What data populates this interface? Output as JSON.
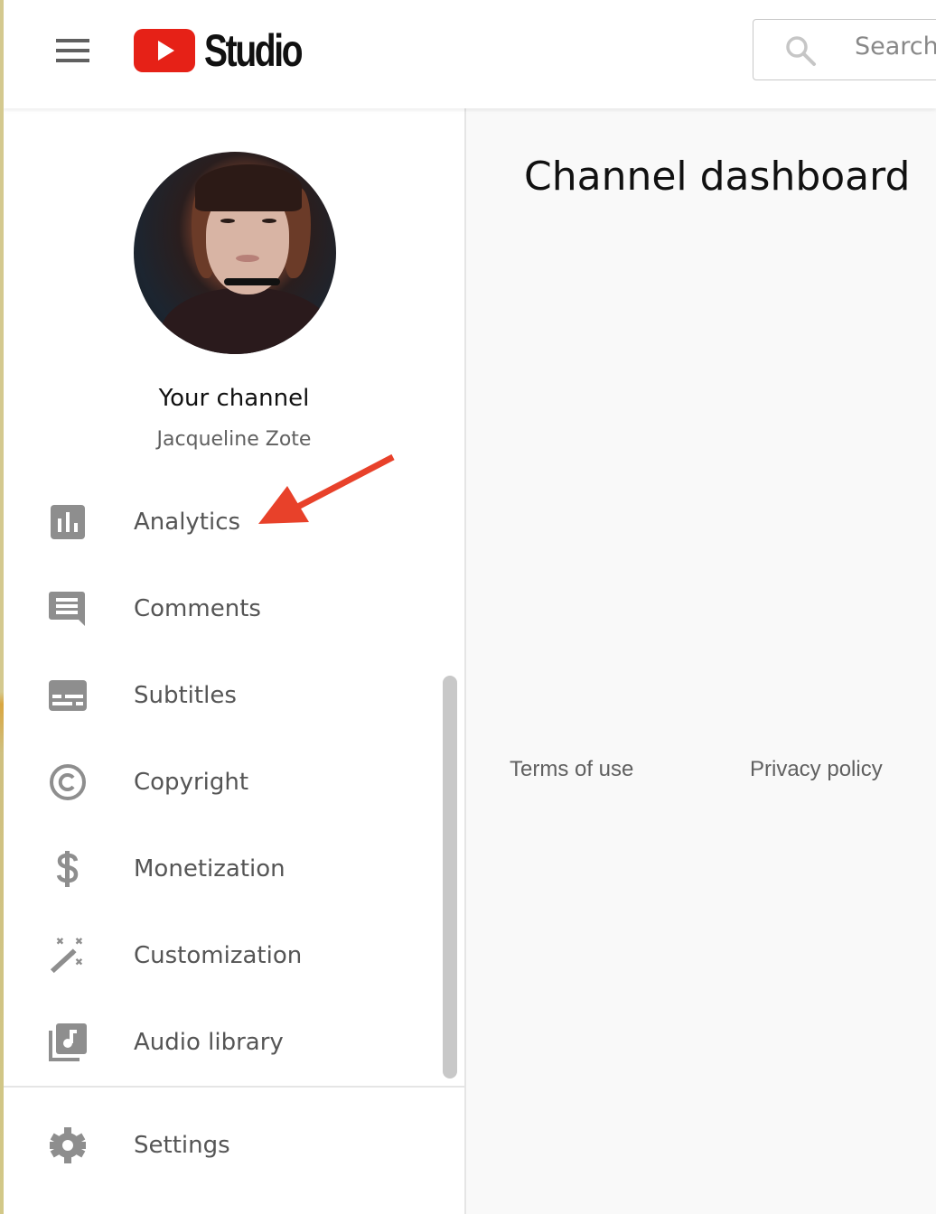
{
  "header": {
    "menu_icon": "hamburger-menu-icon",
    "logo_icon": "youtube-play-icon",
    "logo_text": "Studio",
    "search": {
      "icon": "search-icon",
      "placeholder": "Search",
      "value": ""
    }
  },
  "sidebar": {
    "channel_title": "Your channel",
    "channel_name": "Jacqueline Zote",
    "items": [
      {
        "label": "Analytics",
        "icon": "analytics-bar-chart-icon"
      },
      {
        "label": "Comments",
        "icon": "comment-icon"
      },
      {
        "label": "Subtitles",
        "icon": "subtitles-icon"
      },
      {
        "label": "Copyright",
        "icon": "copyright-icon"
      },
      {
        "label": "Monetization",
        "icon": "dollar-icon"
      },
      {
        "label": "Customization",
        "icon": "magic-wand-icon"
      },
      {
        "label": "Audio library",
        "icon": "audio-library-icon"
      }
    ],
    "settings": {
      "label": "Settings",
      "icon": "gear-icon"
    }
  },
  "main": {
    "title": "Channel dashboard",
    "footer": {
      "terms": "Terms of use",
      "privacy": "Privacy policy"
    }
  },
  "annotation": {
    "arrow_color": "#e8412a",
    "points_to": "Analytics"
  },
  "colors": {
    "brand_red": "#e62117",
    "icon_gray": "#8e8e8e",
    "text_gray": "#555555"
  }
}
